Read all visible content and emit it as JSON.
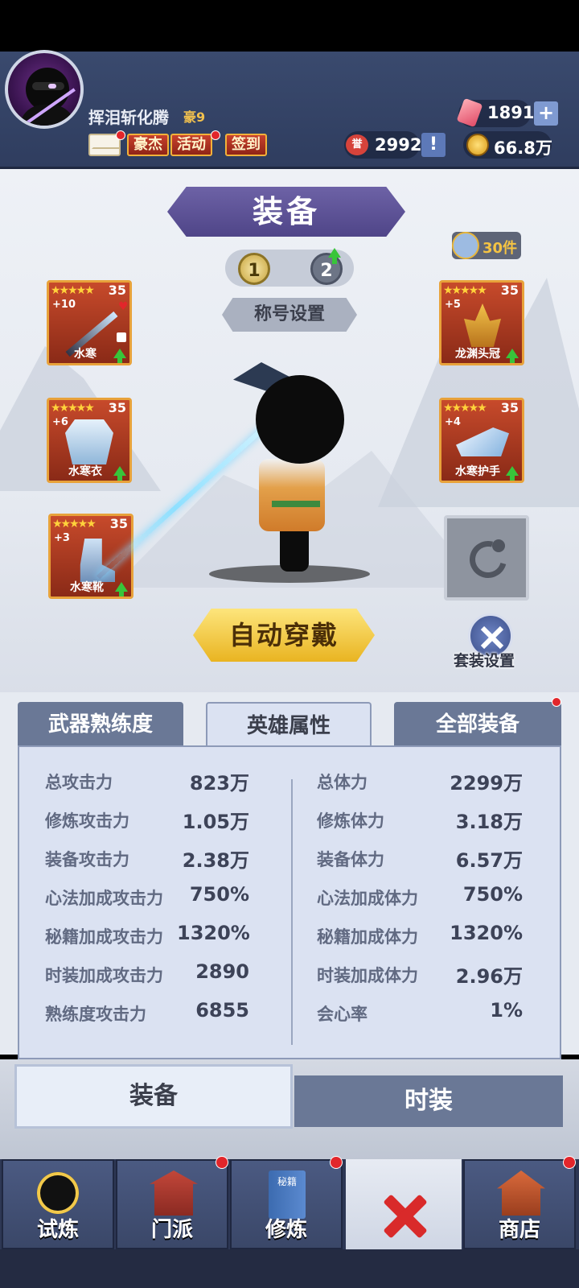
{
  "header": {
    "player_name": "挥泪斩化腾",
    "vip": "豪9",
    "buttons": {
      "hero": "豪杰",
      "event": "活动",
      "checkin": "签到"
    },
    "gems": "1891",
    "honor": "2992",
    "honor_icon_text": "誉",
    "coins": "66.8万",
    "plus": "+",
    "info": "!"
  },
  "equip": {
    "title": "装备",
    "pages": [
      "1",
      "2"
    ],
    "title_setting": "称号设置",
    "item_count": "30件",
    "auto_equip": "自动穿戴",
    "suit_setting": "套装设置",
    "slots": [
      {
        "name": "水寒",
        "level": "35",
        "plus": "+10",
        "stars": "★★★★★"
      },
      {
        "name": "龙渊头冠",
        "level": "35",
        "plus": "+5",
        "stars": "★★★★★"
      },
      {
        "name": "水寒衣",
        "level": "35",
        "plus": "+6",
        "stars": "★★★★★"
      },
      {
        "name": "水寒护手",
        "level": "35",
        "plus": "+4",
        "stars": "★★★★★"
      },
      {
        "name": "水寒靴",
        "level": "35",
        "plus": "+3",
        "stars": "★★★★★"
      }
    ]
  },
  "tabs": {
    "weapon": "武器熟练度",
    "hero": "英雄属性",
    "all": "全部装备"
  },
  "stats": {
    "left": [
      {
        "label": "总攻击力",
        "value": "823万"
      },
      {
        "label": "修炼攻击力",
        "value": "1.05万"
      },
      {
        "label": "装备攻击力",
        "value": "2.38万"
      },
      {
        "label": "心法加成攻击力",
        "value": "750%"
      },
      {
        "label": "秘籍加成攻击力",
        "value": "1320%"
      },
      {
        "label": "时装加成攻击力",
        "value": "2890"
      },
      {
        "label": "熟练度攻击力",
        "value": "6855"
      }
    ],
    "right": [
      {
        "label": "总体力",
        "value": "2299万"
      },
      {
        "label": "修炼体力",
        "value": "3.18万"
      },
      {
        "label": "装备体力",
        "value": "6.57万"
      },
      {
        "label": "心法加成体力",
        "value": "750%"
      },
      {
        "label": "秘籍加成体力",
        "value": "1320%"
      },
      {
        "label": "时装加成体力",
        "value": "2.96万"
      },
      {
        "label": "会心率",
        "value": "1%"
      }
    ]
  },
  "toggle": {
    "equip": "装备",
    "fashion": "时装"
  },
  "nav": {
    "trial": "试炼",
    "sect": "门派",
    "train": "修炼",
    "shop": "商店",
    "book_text": "秘籍"
  }
}
